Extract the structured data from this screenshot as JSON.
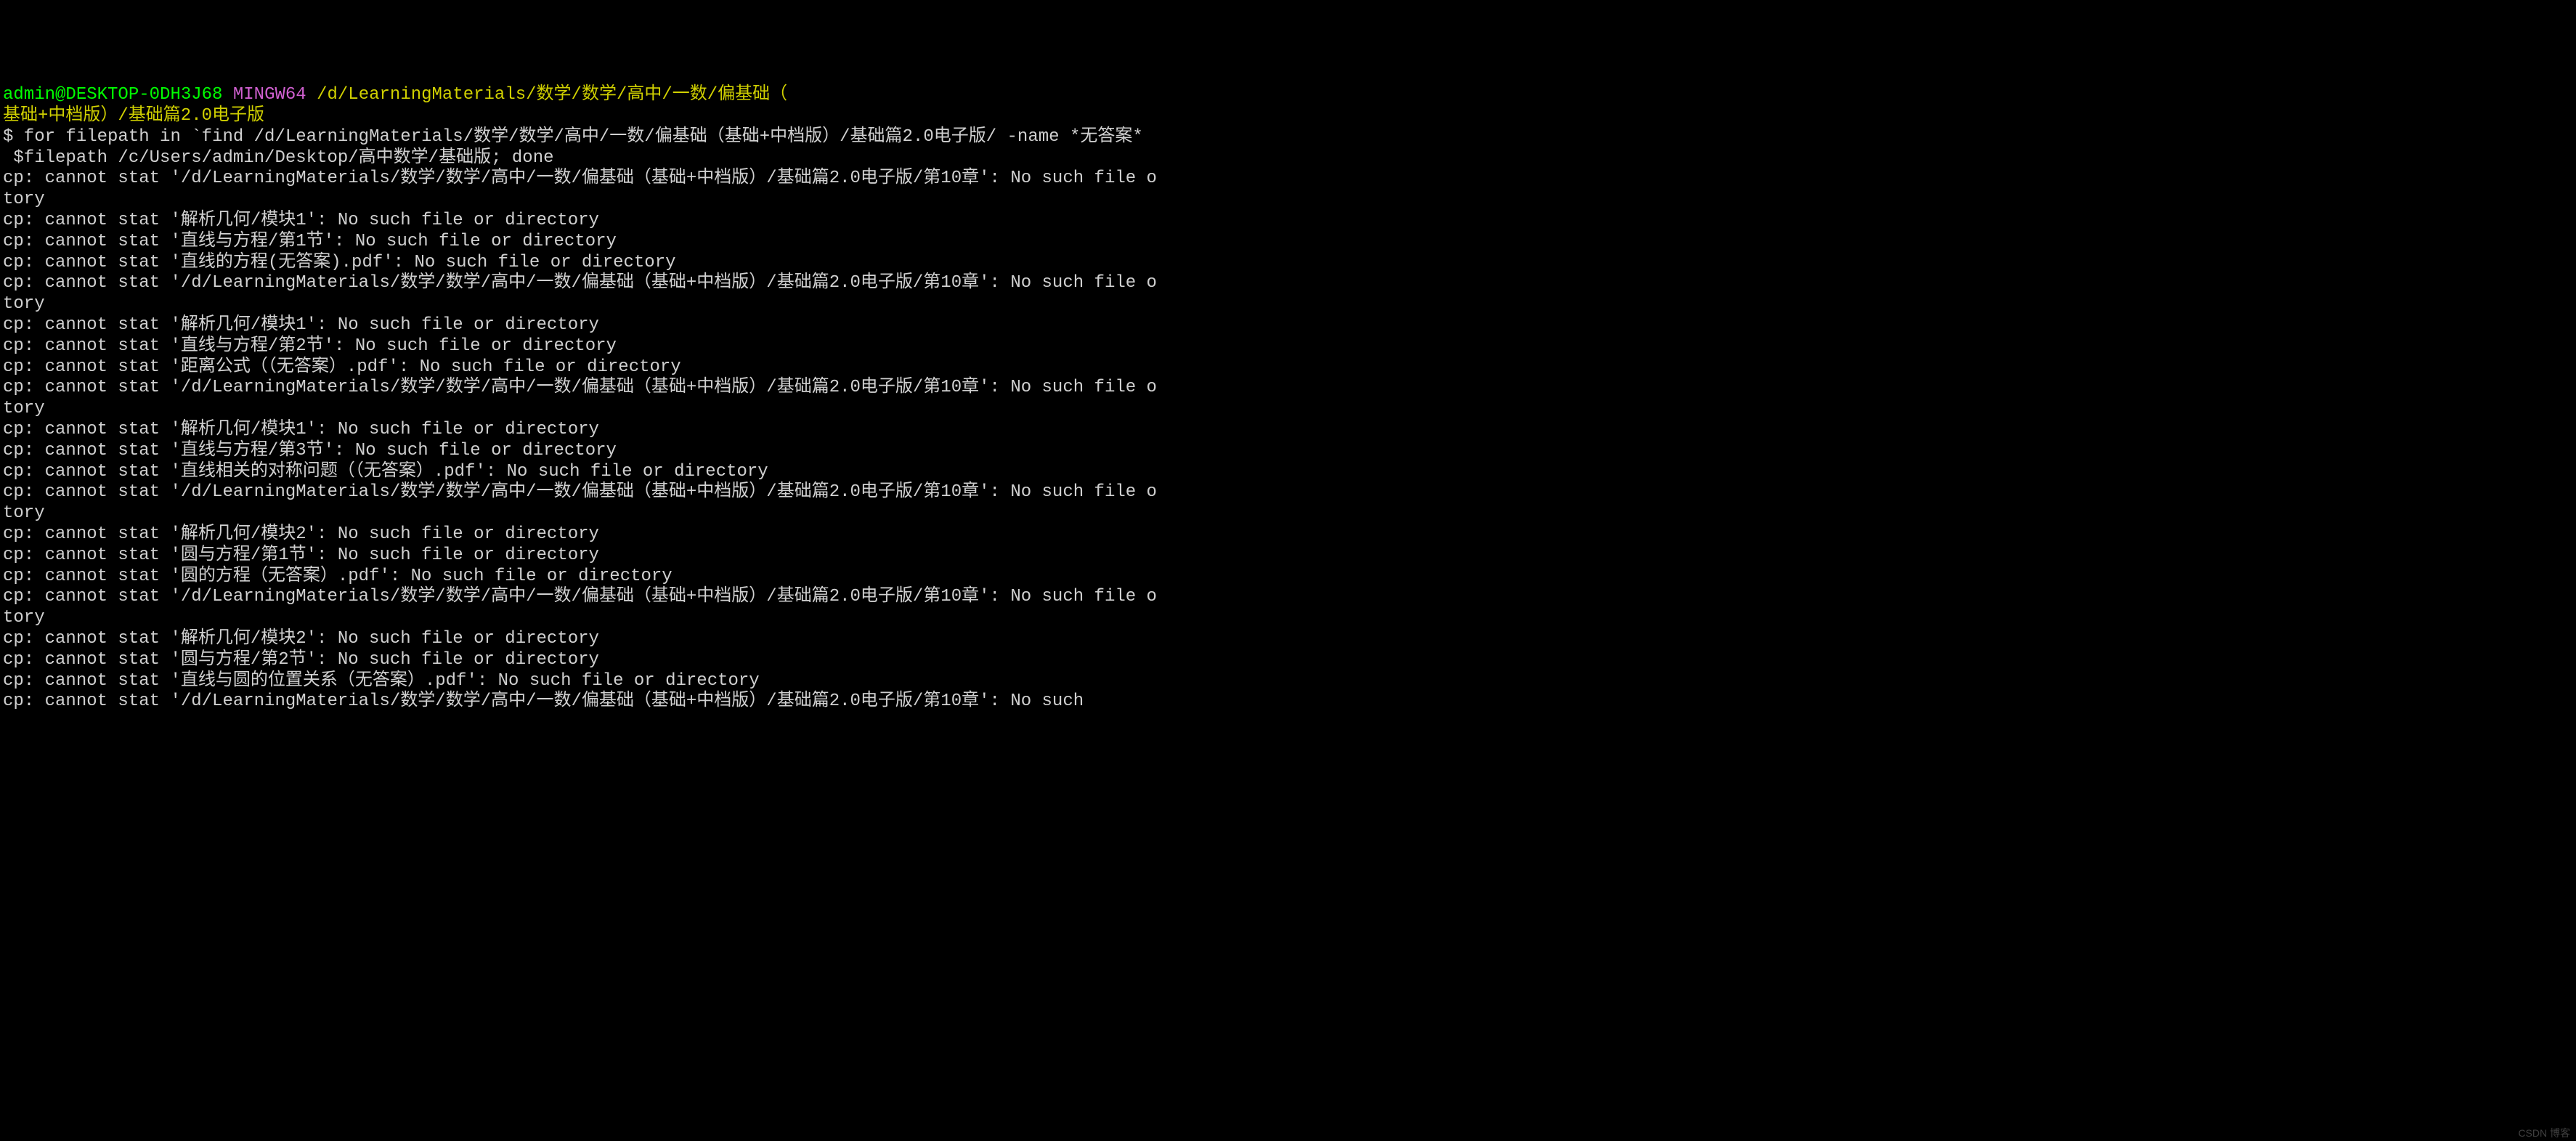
{
  "prompt": {
    "user": "admin@DESKTOP-0DH3J68",
    "mingw": "MINGW64",
    "path_line1": "/d/LearningMaterials/数学/数学/高中/一数/偏基础（",
    "path_line2": "基础+中档版）/基础篇2.0电子版"
  },
  "cmd": {
    "line1": "$ for filepath in `find /d/LearningMaterials/数学/数学/高中/一数/偏基础（基础+中档版）/基础篇2.0电子版/ -name *无答案*",
    "line2": " $filepath /c/Users/admin/Desktop/高中数学/基础版; done"
  },
  "output": [
    "cp: cannot stat '/d/LearningMaterials/数学/数学/高中/一数/偏基础（基础+中档版）/基础篇2.0电子版/第10章': No such file o",
    "tory",
    "cp: cannot stat '解析几何/模块1': No such file or directory",
    "cp: cannot stat '直线与方程/第1节': No such file or directory",
    "cp: cannot stat '直线的方程(无答案).pdf': No such file or directory",
    "cp: cannot stat '/d/LearningMaterials/数学/数学/高中/一数/偏基础（基础+中档版）/基础篇2.0电子版/第10章': No such file o",
    "tory",
    "cp: cannot stat '解析几何/模块1': No such file or directory",
    "cp: cannot stat '直线与方程/第2节': No such file or directory",
    "cp: cannot stat '距离公式（（无答案）.pdf': No such file or directory",
    "cp: cannot stat '/d/LearningMaterials/数学/数学/高中/一数/偏基础（基础+中档版）/基础篇2.0电子版/第10章': No such file o",
    "tory",
    "cp: cannot stat '解析几何/模块1': No such file or directory",
    "cp: cannot stat '直线与方程/第3节': No such file or directory",
    "cp: cannot stat '直线相关的对称问题（（无答案）.pdf': No such file or directory",
    "cp: cannot stat '/d/LearningMaterials/数学/数学/高中/一数/偏基础（基础+中档版）/基础篇2.0电子版/第10章': No such file o",
    "tory",
    "cp: cannot stat '解析几何/模块2': No such file or directory",
    "cp: cannot stat '圆与方程/第1节': No such file or directory",
    "cp: cannot stat '圆的方程（无答案）.pdf': No such file or directory",
    "cp: cannot stat '/d/LearningMaterials/数学/数学/高中/一数/偏基础（基础+中档版）/基础篇2.0电子版/第10章': No such file o",
    "tory",
    "cp: cannot stat '解析几何/模块2': No such file or directory",
    "cp: cannot stat '圆与方程/第2节': No such file or directory",
    "cp: cannot stat '直线与圆的位置关系（无答案）.pdf': No such file or directory",
    "cp: cannot stat '/d/LearningMaterials/数学/数学/高中/一数/偏基础（基础+中档版）/基础篇2.0电子版/第10章': No such"
  ],
  "watermark": "CSDN 博客"
}
